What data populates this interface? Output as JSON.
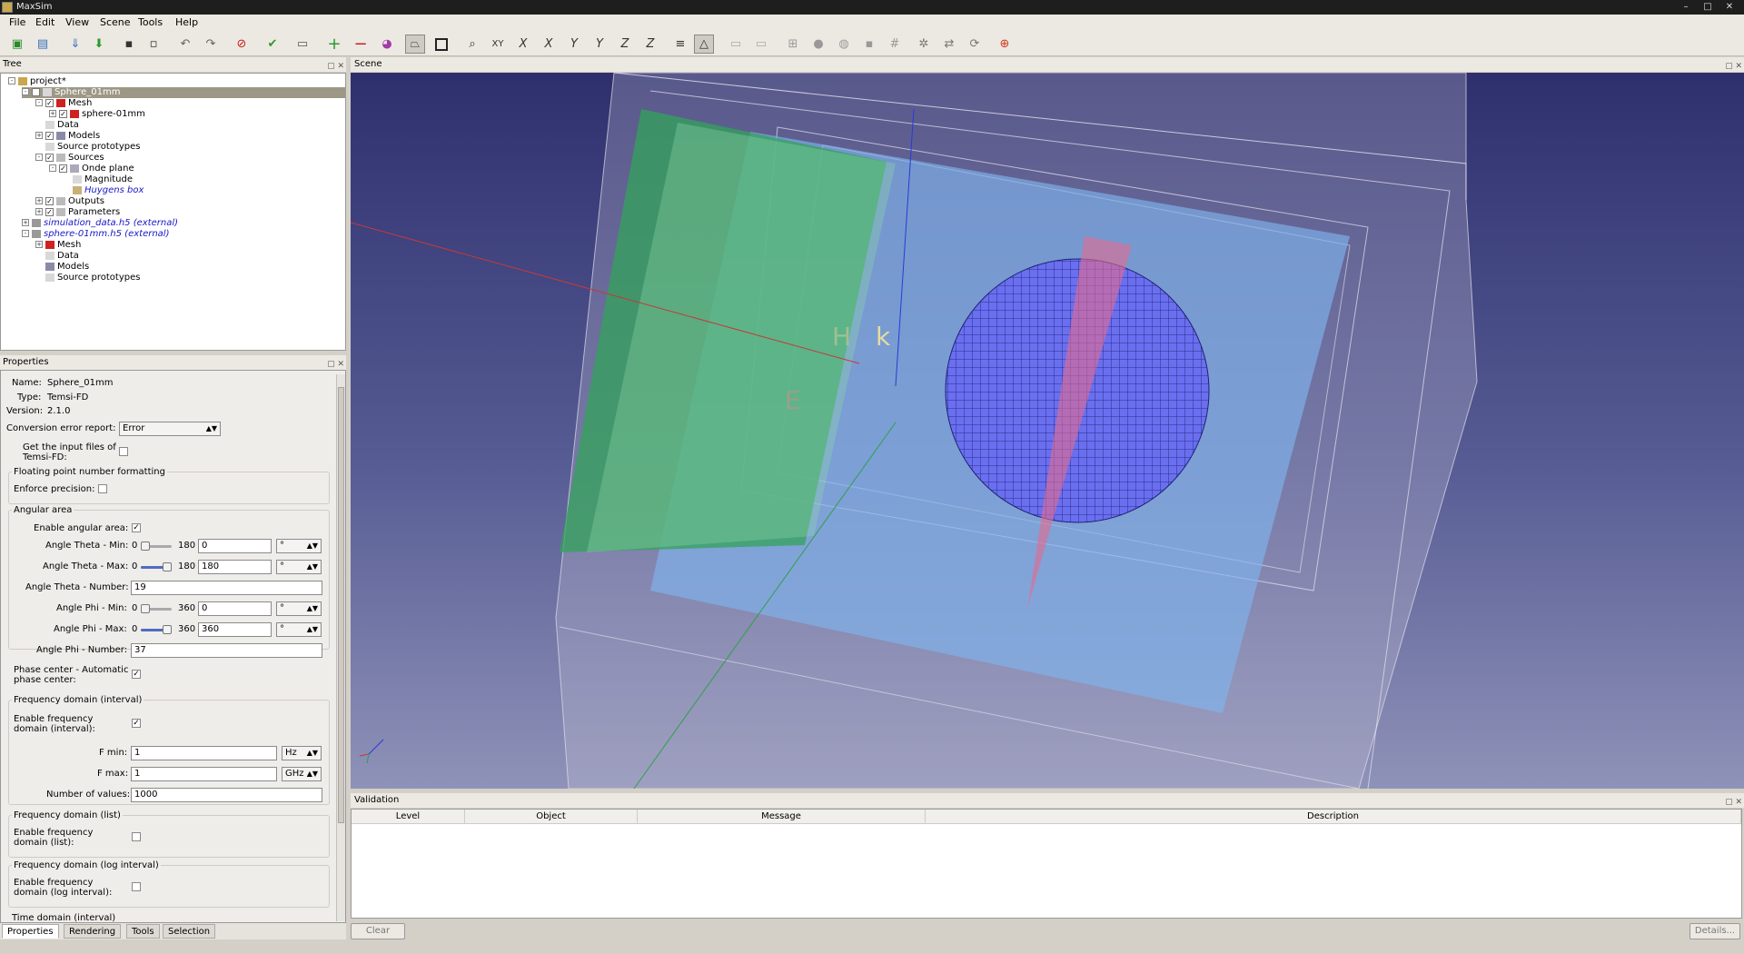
{
  "window": {
    "title": "MaxSim"
  },
  "menu": [
    "File",
    "Edit",
    "View",
    "Scene",
    "Tools",
    "Help"
  ],
  "docks": {
    "tree": "Tree",
    "properties": "Properties",
    "scene": "Scene",
    "validation": "Validation"
  },
  "tree": [
    {
      "label": "project*",
      "indent": 0,
      "expander": "-",
      "checkbox": false,
      "selected": false,
      "italic": false
    },
    {
      "label": "Sphere_01mm",
      "indent": 1,
      "expander": "-",
      "checkbox": true,
      "selected": true,
      "italic": false
    },
    {
      "label": "Mesh",
      "indent": 2,
      "expander": "-",
      "checkbox": true,
      "selected": false,
      "italic": false
    },
    {
      "label": "sphere-01mm",
      "indent": 3,
      "expander": "+",
      "checkbox": true,
      "selected": false,
      "italic": false
    },
    {
      "label": "Data",
      "indent": 2,
      "expander": "",
      "checkbox": false,
      "selected": false,
      "italic": false
    },
    {
      "label": "Models",
      "indent": 2,
      "expander": "+",
      "checkbox": true,
      "selected": false,
      "italic": false
    },
    {
      "label": "Source prototypes",
      "indent": 2,
      "expander": "",
      "checkbox": false,
      "selected": false,
      "italic": false
    },
    {
      "label": "Sources",
      "indent": 2,
      "expander": "-",
      "checkbox": true,
      "selected": false,
      "italic": false
    },
    {
      "label": "Onde plane",
      "indent": 3,
      "expander": "-",
      "checkbox": true,
      "selected": false,
      "italic": false
    },
    {
      "label": "Magnitude",
      "indent": 4,
      "expander": "",
      "checkbox": false,
      "selected": false,
      "italic": false
    },
    {
      "label": "Huygens box",
      "indent": 4,
      "expander": "",
      "checkbox": false,
      "selected": false,
      "italic": true
    },
    {
      "label": "Outputs",
      "indent": 2,
      "expander": "+",
      "checkbox": true,
      "selected": false,
      "italic": false
    },
    {
      "label": "Parameters",
      "indent": 2,
      "expander": "+",
      "checkbox": true,
      "selected": false,
      "italic": false
    },
    {
      "label": "simulation_data.h5 (external)",
      "indent": 1,
      "expander": "+",
      "checkbox": false,
      "selected": false,
      "italic": true
    },
    {
      "label": "sphere-01mm.h5 (external)",
      "indent": 1,
      "expander": "-",
      "checkbox": false,
      "selected": false,
      "italic": true
    },
    {
      "label": "Mesh",
      "indent": 2,
      "expander": "+",
      "checkbox": false,
      "selected": false,
      "italic": false
    },
    {
      "label": "Data",
      "indent": 2,
      "expander": "",
      "checkbox": false,
      "selected": false,
      "italic": false
    },
    {
      "label": "Models",
      "indent": 2,
      "expander": "",
      "checkbox": false,
      "selected": false,
      "italic": false
    },
    {
      "label": "Source prototypes",
      "indent": 2,
      "expander": "",
      "checkbox": false,
      "selected": false,
      "italic": false
    }
  ],
  "properties": {
    "name_label": "Name:",
    "name_value": "Sphere_01mm",
    "type_label": "Type:",
    "type_value": "Temsi-FD",
    "version_label": "Version:",
    "version_value": "2.1.0",
    "conversion_label": "Conversion error report:",
    "conversion_value": "Error",
    "input_files_label": "Get the input files of Temsi-FD:",
    "floating_section": "Floating point number formatting",
    "enforce_label": "Enforce precision:",
    "angular_section": "Angular area",
    "enable_angular_label": "Enable angular area:",
    "theta_min": {
      "label": "Angle Theta - Min:",
      "low": "0",
      "high": "180",
      "value": "0",
      "unit": "°",
      "fraction": 0
    },
    "theta_max": {
      "label": "Angle Theta - Max:",
      "low": "0",
      "high": "180",
      "value": "180",
      "unit": "°",
      "fraction": 1
    },
    "theta_number": {
      "label": "Angle Theta - Number:",
      "value": "19"
    },
    "phi_min": {
      "label": "Angle Phi - Min:",
      "low": "0",
      "high": "360",
      "value": "0",
      "unit": "°",
      "fraction": 0
    },
    "phi_max": {
      "label": "Angle Phi - Max:",
      "low": "0",
      "high": "360",
      "value": "360",
      "unit": "°",
      "fraction": 1
    },
    "phi_number": {
      "label": "Angle Phi - Number:",
      "value": "37"
    },
    "phase_label": "Phase center - Automatic phase center:",
    "freq_interval_section": "Frequency domain (interval)",
    "enable_freq_label": "Enable frequency domain (interval):",
    "fmin": {
      "label": "F min:",
      "value": "1",
      "unit": "Hz"
    },
    "fmax": {
      "label": "F max:",
      "value": "1",
      "unit": "GHz"
    },
    "nvalues": {
      "label": "Number of values:",
      "value": "1000"
    },
    "freq_list_section": "Frequency domain (list)",
    "enable_freq_list_label": "Enable frequency domain (list):",
    "freq_log_section": "Frequency domain (log interval)",
    "enable_freq_log_label": "Enable frequency domain (log interval):",
    "time_section": "Time domain (interval)"
  },
  "bottom_tabs": [
    "Properties",
    "Rendering",
    "Tools",
    "Selection"
  ],
  "scene_labels": {
    "h": "H",
    "k": "k",
    "e": "E"
  },
  "validation": {
    "columns": [
      "Level",
      "Object",
      "Message",
      "Description"
    ],
    "clear_label": "Clear",
    "details_label": "Details..."
  },
  "colors": {
    "selection": "#9d9886",
    "external_link": "#1717c8"
  }
}
